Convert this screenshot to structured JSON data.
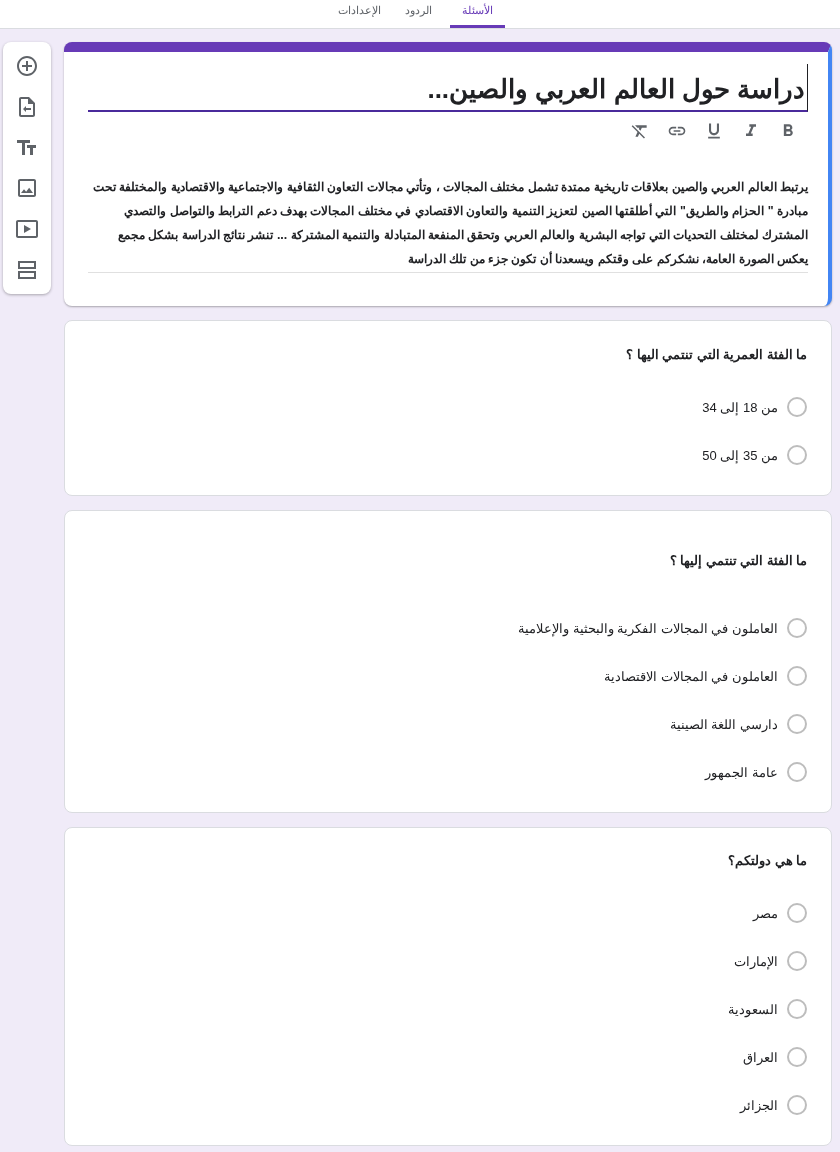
{
  "tabs": [
    {
      "label": "الأسئلة",
      "selected": true
    },
    {
      "label": "الردود",
      "selected": false
    },
    {
      "label": "الإعدادات",
      "selected": false
    }
  ],
  "title_card": {
    "selected": true,
    "title": "دراسة حول العالم العربي والصين...",
    "description": "يرتبط العالم العربي والصين بعلاقات تاريخية ممتدة تشمل مختلف المجالات ، وتأتي مجالات التعاون الثقافية والاجتماعية والاقتصادية والمختلفة تحت مبادرة \" الحزام والطريق\" التي أطلقتها الصين لتعزيز التنمية والتعاون الاقتصادي في مختلف المجالات بهدف دعم الترابط والتواصل والتصدي المشترك لمختلف التحديات التي تواجه البشرية والعالم العربي وتحقق المنفعة المتبادلة والتنمية المشتركة ... تنشر نتائج الدراسة بشكل مجمع يعكس الصورة العامة، نشكركم على وقتكم ويسعدنا أن تكون جزء من تلك الدراسة"
  },
  "questions": [
    {
      "selected": false,
      "question": "ما الفئة العمرية التي تنتمي اليها ؟",
      "options": [
        {
          "label": "من 18 إلى 34",
          "selected": false
        },
        {
          "label": "من 35 إلى 50",
          "selected": false
        }
      ]
    },
    {
      "selected": false,
      "question": "ما الفئة التي تنتمي إليها ؟",
      "options": [
        {
          "label": "العاملون في المجالات الفكرية والبحثية والإعلامية",
          "selected": false
        },
        {
          "label": "العاملون في المجالات الاقتصادية",
          "selected": false
        },
        {
          "label": "دارسي اللغة الصينية",
          "selected": false
        },
        {
          "label": "عامة الجمهور",
          "selected": false
        }
      ]
    },
    {
      "selected": false,
      "question": "ما هي دولتكم؟",
      "options": [
        {
          "label": "مصر",
          "selected": false
        },
        {
          "label": "الإمارات",
          "selected": false
        },
        {
          "label": "السعودية",
          "selected": false
        },
        {
          "label": "العراق",
          "selected": false
        },
        {
          "label": "الجزائر",
          "selected": false
        }
      ]
    }
  ]
}
